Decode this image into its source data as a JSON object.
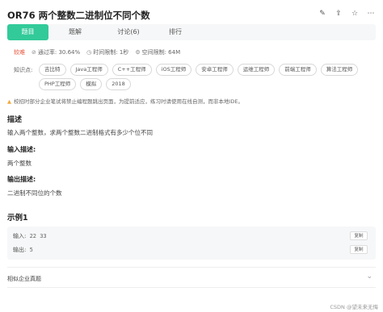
{
  "header": {
    "title": "OR76  两个整数二进制位不同个数",
    "icons": [
      "edit-icon",
      "share-icon",
      "star-icon",
      "more-icon"
    ]
  },
  "tabs": [
    {
      "label": "题目",
      "active": true
    },
    {
      "label": "题解",
      "active": false
    },
    {
      "label": "讨论(6)",
      "active": false
    },
    {
      "label": "排行",
      "active": false
    }
  ],
  "meta": {
    "difficulty": "较难",
    "pass_rate": "通过率: 30.64%",
    "time_limit": "时间限制: 1秒",
    "space_limit": "空间限制: 64M"
  },
  "knowledge": {
    "label": "知识点:",
    "tags": [
      "吉比特",
      "Java工程师",
      "C++工程师",
      "iOS工程师",
      "安卓工程师",
      "运维工程师",
      "前端工程师",
      "算法工程师",
      "PHP工程师",
      "模拟",
      "2018"
    ]
  },
  "notice": "校招时部分企业笔试将禁止编程题跳出页面，为提前适应，练习时请使用在线自测，而非本地IDE。",
  "sections": {
    "desc_title": "描述",
    "desc_text": "输入两个整数，求两个整数二进制格式有多少个位不同",
    "input_title": "输入描述:",
    "input_text": "两个整数",
    "output_title": "输出描述:",
    "output_text": "二进制不同位的个数"
  },
  "example": {
    "title": "示例1",
    "input_label": "输入:",
    "input_value": "22 33",
    "output_label": "输出:",
    "output_value": "5",
    "copy_label": "复制"
  },
  "related": {
    "label": "相似企业真题"
  },
  "watermark": "CSDN @望未来无悔",
  "colors": {
    "accent": "#32ca99",
    "difficulty": "#e8543a",
    "warning": "#f2a93b"
  }
}
